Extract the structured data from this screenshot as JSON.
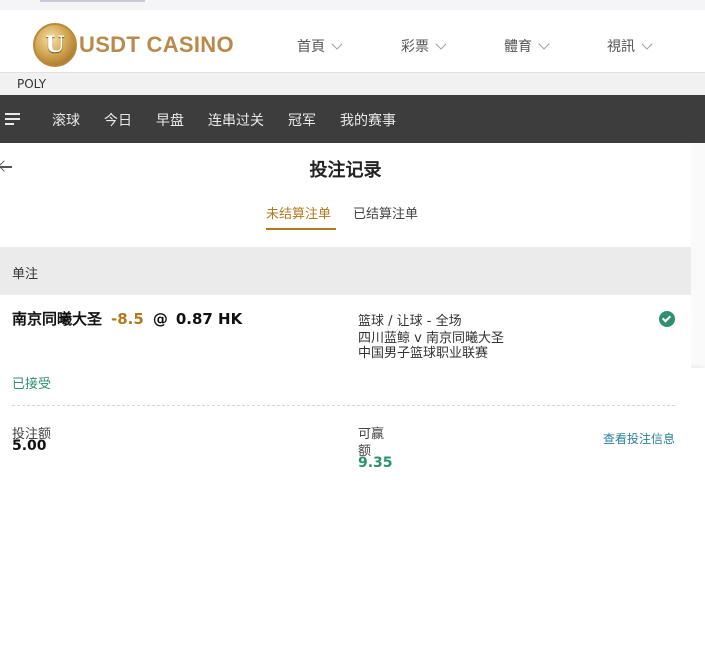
{
  "brand": {
    "logo_letter": "U",
    "name": "USDT CASINO"
  },
  "nav": [
    {
      "label": "首頁"
    },
    {
      "label": "彩票"
    },
    {
      "label": "體育"
    },
    {
      "label": "視訊"
    }
  ],
  "provider": "POLY",
  "sport_tabs": [
    "滚球",
    "今日",
    "早盘",
    "连串过关",
    "冠军",
    "我的赛事"
  ],
  "page": {
    "title": "投注记录",
    "tabs": [
      {
        "label": "未结算注单",
        "active": true
      },
      {
        "label": "已结算注单",
        "active": false
      }
    ],
    "section_label": "单注"
  },
  "bet": {
    "selection": "南京同曦大圣",
    "handicap": "-8.5",
    "at": "@",
    "odds": "0.87 HK",
    "market": "篮球 / 让球 - 全场",
    "match": "四川蓝鲸 v 南京同曦大圣",
    "league": "中国男子篮球职业联赛",
    "status": "已接受",
    "stake_label": "投注额",
    "stake": "5.00",
    "win_label_1": "可赢",
    "win_label_2": "额",
    "win": "9.35",
    "details_link": "查看投注信息"
  },
  "colors": {
    "accent": "#b07a1e",
    "success": "#2f8f6e",
    "dark_bar": "#3d3d3d",
    "link": "#2a7f9a"
  }
}
